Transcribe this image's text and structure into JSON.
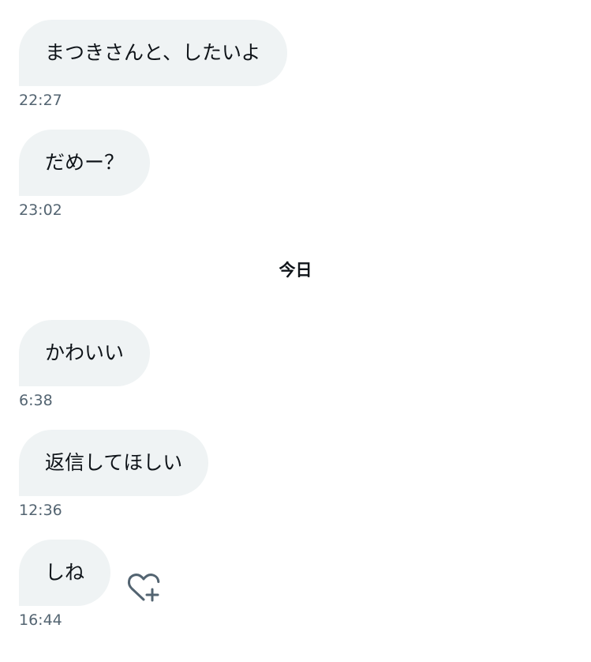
{
  "messages_before": [
    {
      "text": "まつきさんと、したいよ",
      "time": "22:27"
    },
    {
      "text": "だめー？",
      "time": "23:02"
    }
  ],
  "day_separator": "今日",
  "messages_today": [
    {
      "text": "かわいい",
      "time": "6:38"
    },
    {
      "text": "返信してほしい",
      "time": "12:36"
    },
    {
      "text": "しね",
      "time": "16:44"
    }
  ],
  "colors": {
    "bubble": "#eff3f4",
    "text": "#0f1419",
    "timestamp": "#536471"
  },
  "icons": {
    "reaction": "heart-plus-icon"
  }
}
